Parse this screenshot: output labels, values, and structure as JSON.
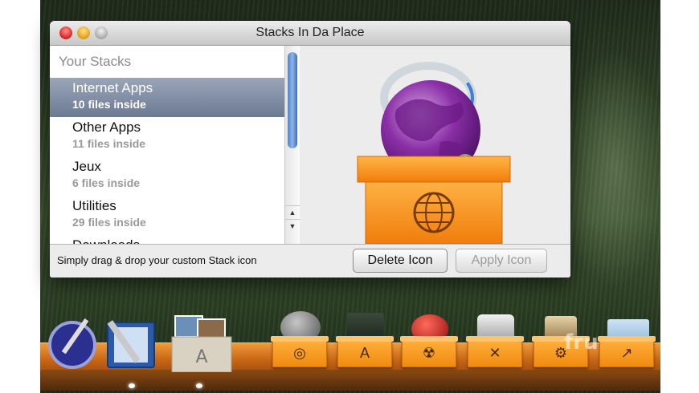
{
  "window": {
    "title": "Stacks In Da Place"
  },
  "list": {
    "header": "Your Stacks",
    "items": [
      {
        "name": "Internet Apps",
        "sub": "10 files inside",
        "selected": true
      },
      {
        "name": "Other Apps",
        "sub": "11 files inside",
        "selected": false
      },
      {
        "name": "Jeux",
        "sub": "6 files inside",
        "selected": false
      },
      {
        "name": "Utilities",
        "sub": "29 files inside",
        "selected": false
      },
      {
        "name": "Downloads",
        "sub": "",
        "selected": false
      }
    ]
  },
  "preview": {
    "icon": "internet-apps-stack-icon"
  },
  "bottom": {
    "hint": "Simply drag & drop your custom Stack icon",
    "delete_label": "Delete Icon",
    "apply_label": "Apply Icon"
  },
  "dock": {
    "items": [
      {
        "icon": "script-editor-icon"
      },
      {
        "icon": "textedit-icon"
      },
      {
        "icon": "applications-stack-icon"
      },
      {
        "icon": "internet-stack-icon"
      },
      {
        "icon": "apps-stack-icon"
      },
      {
        "icon": "games-stack-icon"
      },
      {
        "icon": "utilities-stack-icon"
      },
      {
        "icon": "user-stack-icon"
      },
      {
        "icon": "downloads-stack-icon"
      }
    ]
  },
  "watermark": "fru",
  "colors": {
    "selection": "#6c7a93",
    "stack_orange": "#f08a10",
    "scroll_thumb": "#4f83c9"
  }
}
